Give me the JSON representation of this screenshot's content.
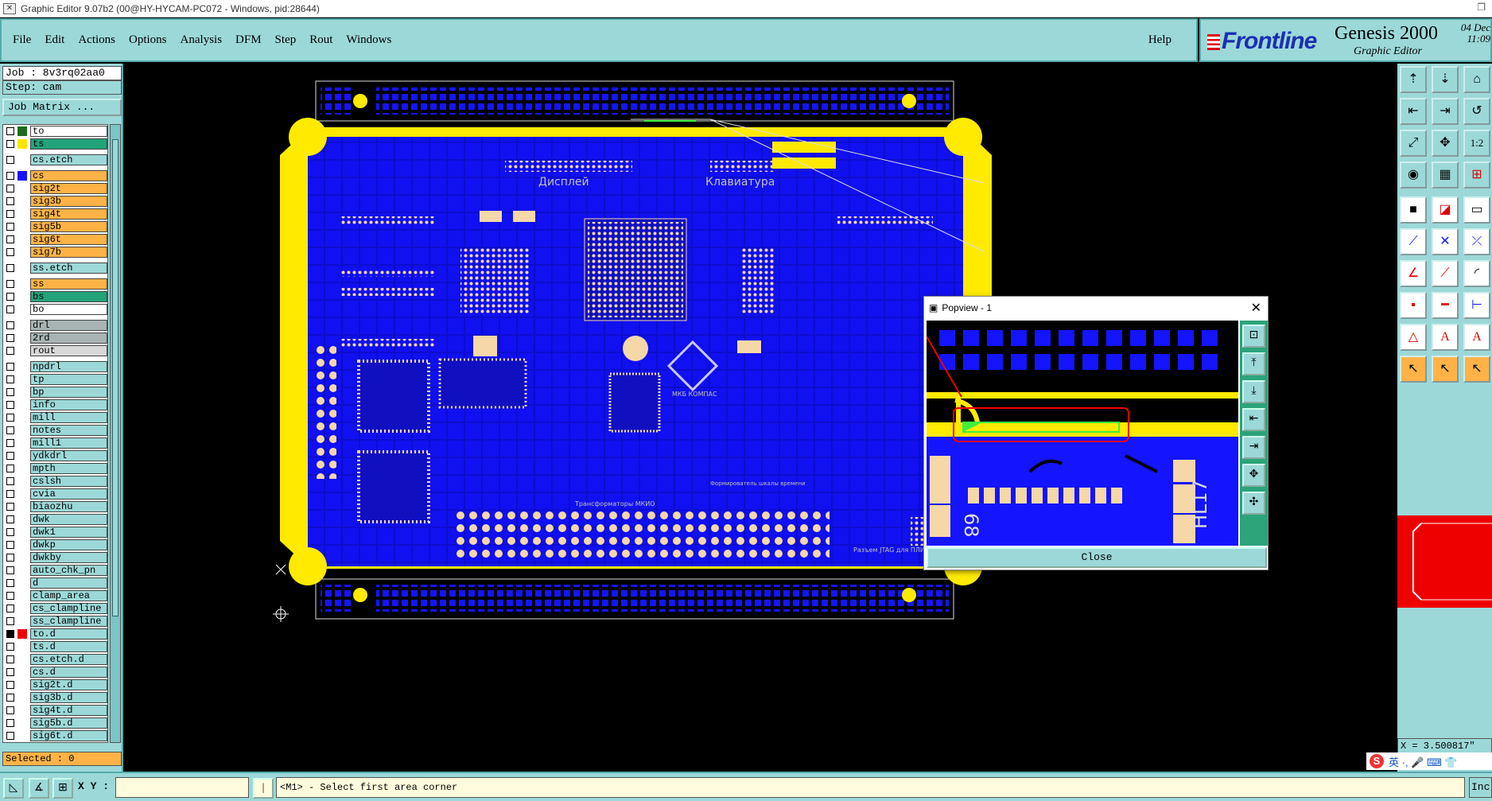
{
  "window": {
    "title": "Graphic Editor 9.07b2 (00@HY-HYCAM-PC072 - Windows, pid:28644)",
    "restore_glyph": "❐"
  },
  "menu": {
    "items": [
      "File",
      "Edit",
      "Actions",
      "Options",
      "Analysis",
      "DFM",
      "Step",
      "Rout",
      "Windows"
    ],
    "help": "Help"
  },
  "brand": {
    "logo": "Frontline",
    "product": "Genesis 2000",
    "subtitle": "Graphic Editor",
    "date": "04 Dec",
    "time": "11:09"
  },
  "info": {
    "job": "Job : 8v3rq02aa0",
    "step": "Step: cam",
    "job_matrix": "Job Matrix ..."
  },
  "layers": [
    {
      "name": "to",
      "color": "#fff",
      "swatch": "#1c6d1c"
    },
    {
      "name": "ts",
      "color": "#22a37a",
      "swatch": "#ffe600"
    },
    {
      "name": "cs.etch",
      "color": "#9cd8d8",
      "swatch": "",
      "gap": true
    },
    {
      "name": "cs",
      "color": "#ffb347",
      "swatch": "#1414ff",
      "gap": true
    },
    {
      "name": "sig2t",
      "color": "#ffb347",
      "swatch": ""
    },
    {
      "name": "sig3b",
      "color": "#ffb347",
      "swatch": ""
    },
    {
      "name": "sig4t",
      "color": "#ffb347",
      "swatch": ""
    },
    {
      "name": "sig5b",
      "color": "#ffb347",
      "swatch": ""
    },
    {
      "name": "sig6t",
      "color": "#ffb347",
      "swatch": ""
    },
    {
      "name": "sig7b",
      "color": "#ffb347",
      "swatch": ""
    },
    {
      "name": "ss.etch",
      "color": "#9cd8d8",
      "swatch": "",
      "gap": true
    },
    {
      "name": "ss",
      "color": "#ffb347",
      "swatch": "",
      "gap": true
    },
    {
      "name": "bs",
      "color": "#22a37a",
      "swatch": ""
    },
    {
      "name": "bo",
      "color": "#fff",
      "swatch": ""
    },
    {
      "name": "drl",
      "color": "#a8b4b4",
      "swatch": "",
      "gap": true
    },
    {
      "name": "2rd",
      "color": "#a8b4b4",
      "swatch": ""
    },
    {
      "name": "rout",
      "color": "#d8d8d8",
      "swatch": ""
    },
    {
      "name": "npdrl",
      "color": "#9cd8d8",
      "swatch": "",
      "gap": true
    },
    {
      "name": "tp",
      "color": "#9cd8d8",
      "swatch": ""
    },
    {
      "name": "bp",
      "color": "#9cd8d8",
      "swatch": ""
    },
    {
      "name": "info",
      "color": "#9cd8d8",
      "swatch": ""
    },
    {
      "name": "mill",
      "color": "#9cd8d8",
      "swatch": ""
    },
    {
      "name": "notes",
      "color": "#9cd8d8",
      "swatch": ""
    },
    {
      "name": "mill1",
      "color": "#9cd8d8",
      "swatch": ""
    },
    {
      "name": "ydkdrl",
      "color": "#9cd8d8",
      "swatch": ""
    },
    {
      "name": "mpth",
      "color": "#9cd8d8",
      "swatch": ""
    },
    {
      "name": "cslsh",
      "color": "#9cd8d8",
      "swatch": ""
    },
    {
      "name": "cvia",
      "color": "#9cd8d8",
      "swatch": ""
    },
    {
      "name": "biaozhu",
      "color": "#9cd8d8",
      "swatch": ""
    },
    {
      "name": "dwk",
      "color": "#9cd8d8",
      "swatch": ""
    },
    {
      "name": "dwk1",
      "color": "#9cd8d8",
      "swatch": ""
    },
    {
      "name": "dwkp",
      "color": "#9cd8d8",
      "swatch": ""
    },
    {
      "name": "dwkby",
      "color": "#9cd8d8",
      "swatch": ""
    },
    {
      "name": "auto_chk_pn",
      "color": "#9cd8d8",
      "swatch": ""
    },
    {
      "name": "d",
      "color": "#9cd8d8",
      "swatch": ""
    },
    {
      "name": "clamp_area",
      "color": "#9cd8d8",
      "swatch": ""
    },
    {
      "name": "cs_clampline",
      "color": "#9cd8d8",
      "swatch": ""
    },
    {
      "name": "ss_clampline",
      "color": "#9cd8d8",
      "swatch": ""
    },
    {
      "name": "to.d",
      "color": "#9cd8d8",
      "swatch": "#e00",
      "checked": true
    },
    {
      "name": "ts.d",
      "color": "#9cd8d8",
      "swatch": ""
    },
    {
      "name": "cs.etch.d",
      "color": "#9cd8d8",
      "swatch": ""
    },
    {
      "name": "cs.d",
      "color": "#9cd8d8",
      "swatch": ""
    },
    {
      "name": "sig2t.d",
      "color": "#9cd8d8",
      "swatch": ""
    },
    {
      "name": "sig3b.d",
      "color": "#9cd8d8",
      "swatch": ""
    },
    {
      "name": "sig4t.d",
      "color": "#9cd8d8",
      "swatch": ""
    },
    {
      "name": "sig5b.d",
      "color": "#9cd8d8",
      "swatch": ""
    },
    {
      "name": "sig6t.d",
      "color": "#9cd8d8",
      "swatch": ""
    }
  ],
  "selected": "Selected : 0",
  "board": {
    "label_display": "Дисплей",
    "label_keyboard": "Клавиатура",
    "label_logo": "МКБ КОМПАС",
    "label_transformers": "Трансформаторы МКИО",
    "label_jtag": "Разъем JTAG для ПЛИС",
    "label_time": "Формирователь шкалы времени"
  },
  "popview": {
    "title": "Popview - 1",
    "close_label": "Close",
    "close_glyph": "✕",
    "part_label": "HL17",
    "part_label2": "68"
  },
  "readout": {
    "x": "X = 3.500817\""
  },
  "status": {
    "xy_label": "X Y :",
    "message": "<M1> - Select first area corner",
    "inc": "Inc"
  },
  "ime": {
    "text": "英 ·, 🎤 ⌨ 👕"
  }
}
